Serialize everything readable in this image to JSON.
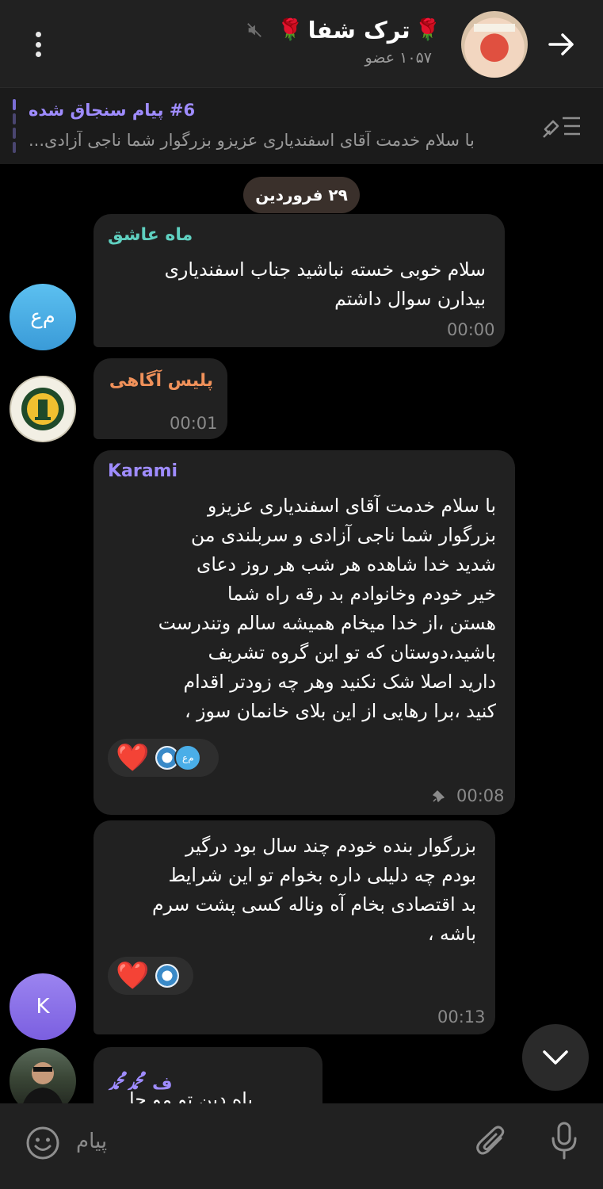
{
  "header": {
    "title": "ترک شفا",
    "members": "۱۰۵۷ عضو",
    "rose_glyph": "🌹"
  },
  "pinned": {
    "title": "#6 پیام سنجاق شده",
    "text": "با سلام خدمت آقای اسفندیاری عزیزو بزرگوار شما ناجی آزادی..."
  },
  "date_chip": "۲۹ فروردین",
  "messages": [
    {
      "sender": "ماه عاشق",
      "sender_color": "#5fd0c0",
      "avatar_text": "م‌ع",
      "lines": [
        "سلام خوبی خسته نباشید جناب اسفندیاری",
        "بیدارن سوال داشتم"
      ],
      "time": "00:00"
    },
    {
      "sender": "پلیس آگاهی",
      "sender_color": "#f0915a",
      "avatar_icon": "police-emblem-icon",
      "time": "00:01"
    },
    {
      "sender": "Karami",
      "sender_color": "#9f8cff",
      "lines": [
        "با سلام خدمت آقای اسفندیاری عزیزو",
        "بزرگوار شما ناجی آزادی و سربلندی من",
        "شدید خدا شاهده هر شب هر روز دعای",
        "خیر خودم وخانوادم بد رقه راه شما",
        "هستن ،از خدا میخام همیشه سالم وتندرست",
        "باشید،دوستان که تو این گروه تشریف",
        "دارید اصلا شک نکنید وهر چه زودتر اقدام",
        "کنید ،برا رهایی از این بلای خانمان سوز ،"
      ],
      "reaction": "❤️",
      "reaction_avatar_text": "م‌ع",
      "time": "00:08"
    },
    {
      "avatar_text": "K",
      "lines": [
        "بزرگوار بنده خودم چند سال بود درگیر",
        "بودم چه دلیلی داره بخوام تو این شرایط",
        "بد اقتصادی بخام آه وناله کسی پشت سرم",
        "باشه ،"
      ],
      "reaction": "❤️",
      "time": "00:13"
    },
    {
      "sender": "ف ﷴﷴ",
      "sender_color": "#9f8cff",
      "partial_text": "باه دین تو مو حا"
    }
  ],
  "composer": {
    "placeholder": "پیام"
  },
  "colors": {
    "background": "#000000",
    "bubble": "#212121",
    "header": "#212121",
    "accent": "#9f8cff"
  }
}
